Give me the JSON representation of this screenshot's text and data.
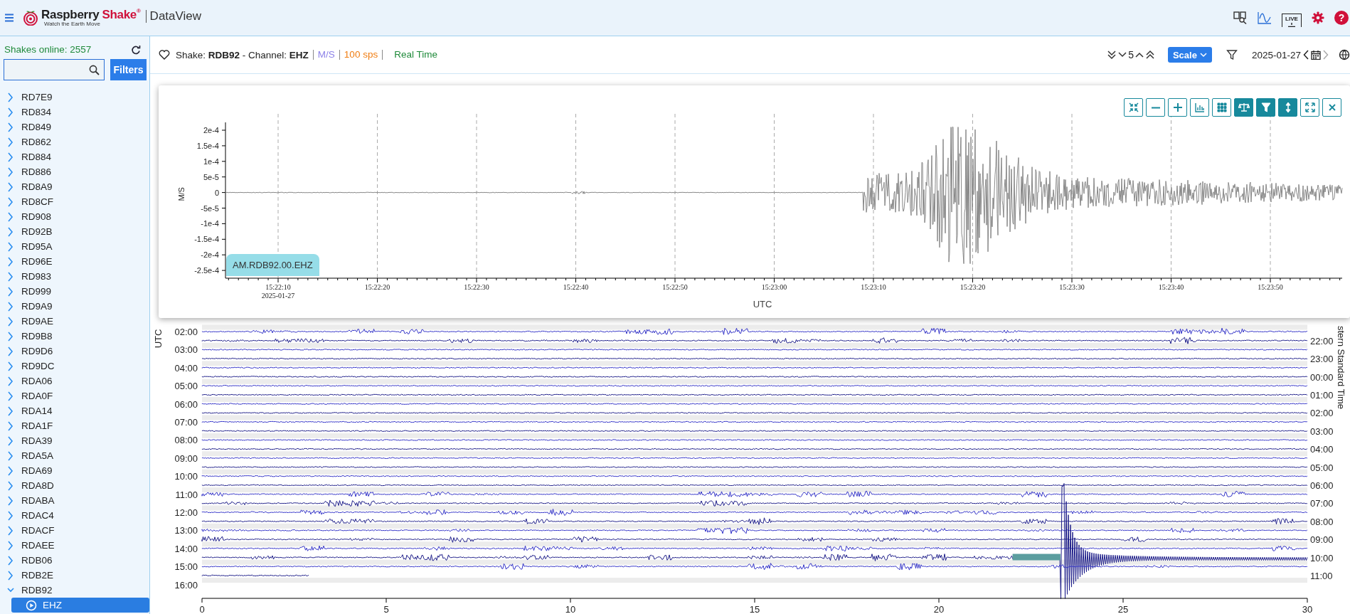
{
  "header": {
    "brand": [
      "Raspberry",
      "Shake"
    ],
    "brand_mark": "®",
    "tagline": "Watch the Earth Move",
    "app_name": "DataView",
    "live_label": "LIVE",
    "help_label": "?"
  },
  "sidebar": {
    "online": "Shakes online: 2557",
    "filters_button": "Filters",
    "items": [
      {
        "kind": "station",
        "label": "RD7E9",
        "expanded": false,
        "selected": false
      },
      {
        "kind": "station",
        "label": "RD834",
        "expanded": false,
        "selected": false
      },
      {
        "kind": "station",
        "label": "RD849",
        "expanded": false,
        "selected": false
      },
      {
        "kind": "station",
        "label": "RD862",
        "expanded": false,
        "selected": false
      },
      {
        "kind": "station",
        "label": "RD884",
        "expanded": false,
        "selected": false
      },
      {
        "kind": "station",
        "label": "RD886",
        "expanded": false,
        "selected": false
      },
      {
        "kind": "station",
        "label": "RD8A9",
        "expanded": false,
        "selected": false
      },
      {
        "kind": "station",
        "label": "RD8CF",
        "expanded": false,
        "selected": false
      },
      {
        "kind": "station",
        "label": "RD908",
        "expanded": false,
        "selected": false
      },
      {
        "kind": "station",
        "label": "RD92B",
        "expanded": false,
        "selected": false
      },
      {
        "kind": "station",
        "label": "RD95A",
        "expanded": false,
        "selected": false
      },
      {
        "kind": "station",
        "label": "RD96E",
        "expanded": false,
        "selected": false
      },
      {
        "kind": "station",
        "label": "RD983",
        "expanded": false,
        "selected": false
      },
      {
        "kind": "station",
        "label": "RD999",
        "expanded": false,
        "selected": false
      },
      {
        "kind": "station",
        "label": "RD9A9",
        "expanded": false,
        "selected": false
      },
      {
        "kind": "station",
        "label": "RD9AE",
        "expanded": false,
        "selected": false
      },
      {
        "kind": "station",
        "label": "RD9B8",
        "expanded": false,
        "selected": false
      },
      {
        "kind": "station",
        "label": "RD9D6",
        "expanded": false,
        "selected": false
      },
      {
        "kind": "station",
        "label": "RD9DC",
        "expanded": false,
        "selected": false
      },
      {
        "kind": "station",
        "label": "RDA06",
        "expanded": false,
        "selected": false
      },
      {
        "kind": "station",
        "label": "RDA0F",
        "expanded": false,
        "selected": false
      },
      {
        "kind": "station",
        "label": "RDA14",
        "expanded": false,
        "selected": false
      },
      {
        "kind": "station",
        "label": "RDA1F",
        "expanded": false,
        "selected": false
      },
      {
        "kind": "station",
        "label": "RDA39",
        "expanded": false,
        "selected": false
      },
      {
        "kind": "station",
        "label": "RDA5A",
        "expanded": false,
        "selected": false
      },
      {
        "kind": "station",
        "label": "RDA69",
        "expanded": false,
        "selected": false
      },
      {
        "kind": "station",
        "label": "RDA8D",
        "expanded": false,
        "selected": false
      },
      {
        "kind": "station",
        "label": "RDABA",
        "expanded": false,
        "selected": false
      },
      {
        "kind": "station",
        "label": "RDAC4",
        "expanded": false,
        "selected": false
      },
      {
        "kind": "station",
        "label": "RDACF",
        "expanded": false,
        "selected": false
      },
      {
        "kind": "station",
        "label": "RDAEE",
        "expanded": false,
        "selected": false
      },
      {
        "kind": "station",
        "label": "RDB06",
        "expanded": false,
        "selected": false
      },
      {
        "kind": "station",
        "label": "RDB2E",
        "expanded": false,
        "selected": false
      },
      {
        "kind": "station",
        "label": "RDB92",
        "expanded": true,
        "selected": false,
        "children": [
          {
            "kind": "channel",
            "label": "EHZ",
            "selected": true
          }
        ]
      }
    ]
  },
  "toolbar": {
    "title": "Shake: **RDB92** - Channel: **EHZ**",
    "units": "M/S",
    "rate": "100 sps",
    "mode": "Real Time",
    "count": "5",
    "scale_button": "Scale",
    "date": "2025-01-27",
    "next_disabled": true
  },
  "seismogram": {
    "trace_label": "AM.RDB92.00.EHZ",
    "y_title": "M/S",
    "x_title": "UTC",
    "date_label": "2025-01-27",
    "y_ticks": [
      "2e-4",
      "1.5e-4",
      "1e-4",
      "5e-5",
      "0",
      "-5e-5",
      "-1e-4",
      "-1.5e-4",
      "-2e-4",
      "-2.5e-4"
    ],
    "x_ticks": [
      "15:22:10",
      "15:22:20",
      "15:22:30",
      "15:22:40",
      "15:22:50",
      "15:23:00",
      "15:23:10",
      "15:23:20",
      "15:23:30",
      "15:23:40",
      "15:23:50"
    ],
    "tools": [
      {
        "kind": "collapse",
        "selected": false
      },
      {
        "kind": "zoom-out",
        "selected": false
      },
      {
        "kind": "zoom-in",
        "selected": false
      },
      {
        "kind": "bar-chart",
        "selected": false
      },
      {
        "kind": "grid",
        "selected": false
      },
      {
        "kind": "scale",
        "selected": true
      },
      {
        "kind": "filter",
        "selected": true
      },
      {
        "kind": "vertical-arrows",
        "selected": true
      },
      {
        "kind": "expand",
        "selected": false
      },
      {
        "kind": "close",
        "selected": false
      }
    ]
  },
  "helicorder": {
    "left_title": "UTC",
    "right_title": "stern Standard Time",
    "left_ticks": [
      "02:00",
      "03:00",
      "04:00",
      "05:00",
      "06:00",
      "07:00",
      "08:00",
      "09:00",
      "10:00",
      "11:00",
      "12:00",
      "13:00",
      "14:00",
      "15:00",
      "16:00"
    ],
    "right_ticks": [
      "22:00",
      "23:00",
      "00:00",
      "01:00",
      "02:00",
      "03:00",
      "04:00",
      "05:00",
      "06:00",
      "07:00",
      "08:00",
      "09:00",
      "10:00",
      "11:00"
    ],
    "x_ticks": [
      "0",
      "5",
      "10",
      "15",
      "20",
      "25",
      "30"
    ]
  }
}
